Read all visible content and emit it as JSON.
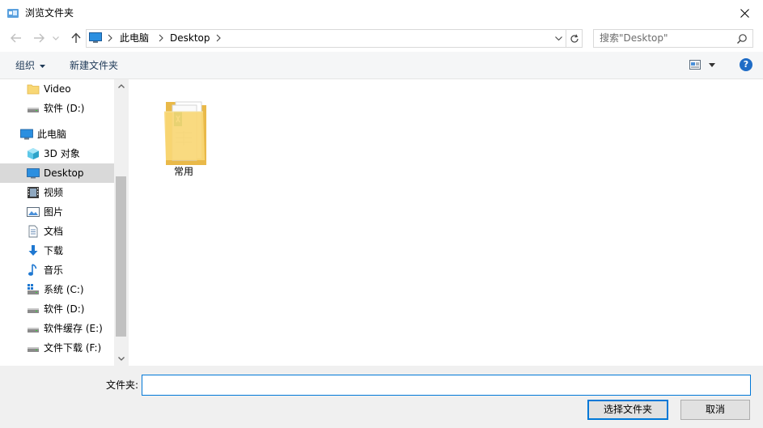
{
  "window": {
    "title": "浏览文件夹",
    "close_icon": "close-icon"
  },
  "nav": {
    "back_icon": "arrow-left-icon",
    "forward_icon": "arrow-right-icon",
    "recent_icon": "chevron-down-icon",
    "up_icon": "arrow-up-icon"
  },
  "address": {
    "segments": [
      "此电脑",
      "Desktop"
    ],
    "refresh_icon": "refresh-icon"
  },
  "search": {
    "placeholder": "搜索\"Desktop\""
  },
  "toolbar": {
    "organize_label": "组织",
    "new_folder_label": "新建文件夹",
    "view_icon": "view-icon",
    "help_label": "?"
  },
  "sidebar": {
    "items": [
      {
        "label": "Video",
        "icon": "folder-icon"
      },
      {
        "label": "软件 (D:)",
        "icon": "drive-icon"
      },
      {
        "label": "此电脑",
        "icon": "computer-icon"
      },
      {
        "label": "3D 对象",
        "icon": "cube-icon"
      },
      {
        "label": "Desktop",
        "icon": "desktop-icon",
        "selected": true
      },
      {
        "label": "视频",
        "icon": "film-icon"
      },
      {
        "label": "图片",
        "icon": "picture-icon"
      },
      {
        "label": "文档",
        "icon": "document-icon"
      },
      {
        "label": "下载",
        "icon": "download-icon"
      },
      {
        "label": "音乐",
        "icon": "music-icon"
      },
      {
        "label": "系统 (C:)",
        "icon": "system-drive-icon"
      },
      {
        "label": "软件 (D:)",
        "icon": "drive-icon"
      },
      {
        "label": "软件缓存 (E:)",
        "icon": "drive-icon"
      },
      {
        "label": "文件下载 (F:)",
        "icon": "drive-icon"
      }
    ]
  },
  "content": {
    "items": [
      {
        "label": "常用",
        "icon": "folder-icon"
      }
    ]
  },
  "footer": {
    "folder_label": "文件夹:",
    "folder_value": "",
    "select_button": "选择文件夹",
    "cancel_button": "取消"
  },
  "colors": {
    "accent": "#0078d7",
    "toolbar_text": "#1e3957",
    "selection": "#d9d9d9",
    "bottom_bg": "#f0f0f0"
  }
}
